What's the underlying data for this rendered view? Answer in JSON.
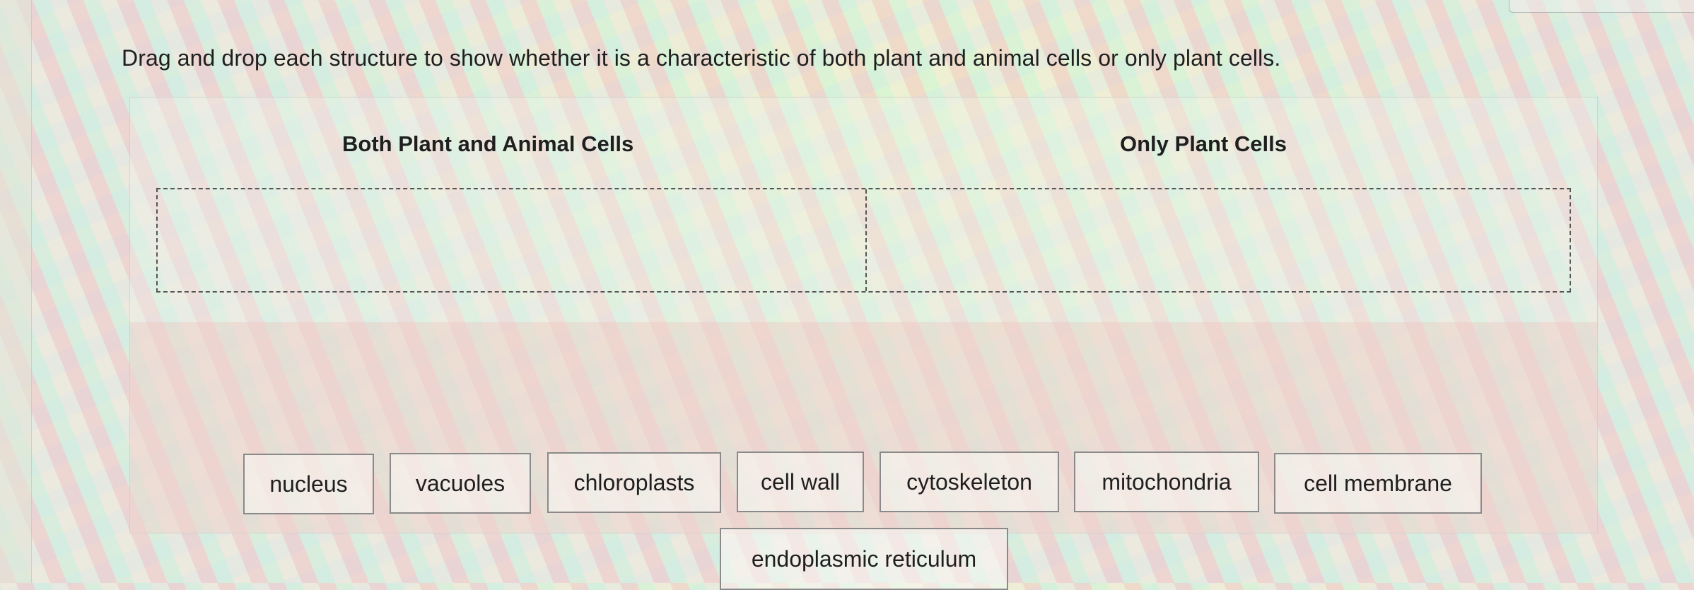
{
  "instructions": "Drag and drop each structure to show whether it is a characteristic of both plant and animal cells or only plant cells.",
  "columns": {
    "left": "Both Plant and Animal Cells",
    "right": "Only Plant Cells"
  },
  "items": [
    "nucleus",
    "vacuoles",
    "chloroplasts",
    "cell wall",
    "cytoskeleton",
    "mitochondria",
    "cell membrane",
    "endoplasmic reticulum"
  ]
}
